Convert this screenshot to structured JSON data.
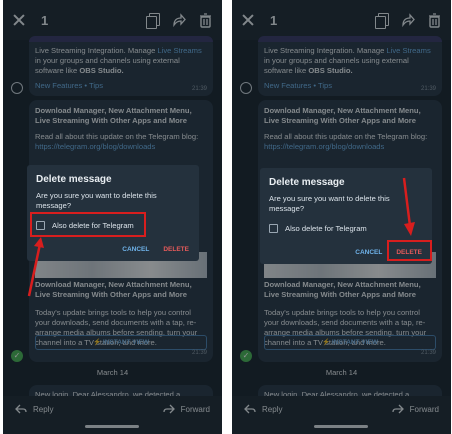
{
  "topbar": {
    "count": "1",
    "icons": [
      "close-icon",
      "copy-icon",
      "forward-icon",
      "delete-icon"
    ]
  },
  "messages": {
    "first": {
      "text_a": "Live Streaming Integration. Manage ",
      "text_link": "Live Streams",
      "text_b": " in your groups and channels using external software like ",
      "text_bold": "OBS Studio.",
      "tags": "New Features • Tips",
      "time": "21:39"
    },
    "second": {
      "heading": "Download Manager, New Attachment Menu, Live Streaming With Other Apps and More",
      "read": "Read all about this update on the Telegram blog:",
      "link": "https://telegram.org/blog/downloads",
      "card_title": "Download Manager, New Attachment Menu, Live Streaming With Other Apps and More",
      "card_desc": "Today's update brings tools to help you control your downloads, send documents with a tap, re-arrange media albums before sending, turn your channel into a TV station, and more.",
      "instant_view": "⚡ INSTANT VIEW",
      "time": "21:39"
    },
    "date": "March 14",
    "third": "New login. Dear Alessandro, we detected a"
  },
  "dialog": {
    "title": "Delete message",
    "message": "Are you sure you want to delete this message?",
    "option": "Also delete for Telegram",
    "cancel": "CANCEL",
    "delete": "DELETE"
  },
  "bottombar": {
    "reply": "Reply",
    "forward": "Forward"
  },
  "colors": {
    "annotation": "#d81e1e",
    "link": "#6fb3ea",
    "delete": "#e65a5a",
    "check": "#4cb75a"
  }
}
